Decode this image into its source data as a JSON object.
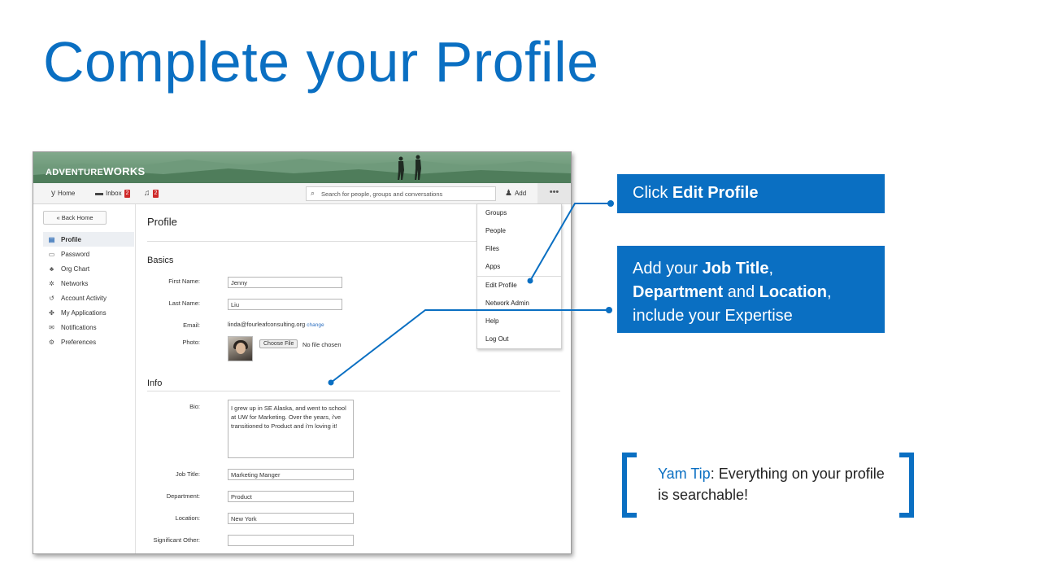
{
  "slide": {
    "title": "Complete your Profile",
    "accent_color": "#0a6fc2"
  },
  "app": {
    "brand": "ADVENTURE",
    "brand_bold": "WORKS",
    "nav": {
      "home_label": "Home",
      "inbox_label": "Inbox",
      "inbox_count": "2",
      "notifications_count": "2",
      "search_placeholder": "Search for people, groups and conversations",
      "add_label": "Add",
      "more_label": "•••"
    },
    "sidebar": {
      "back_label": "« Back Home",
      "items": [
        {
          "label": "Profile",
          "icon": "profile-card-icon",
          "active": true
        },
        {
          "label": "Password",
          "icon": "password-icon",
          "active": false
        },
        {
          "label": "Org Chart",
          "icon": "org-chart-icon",
          "active": false
        },
        {
          "label": "Networks",
          "icon": "networks-icon",
          "active": false
        },
        {
          "label": "Account Activity",
          "icon": "history-icon",
          "active": false
        },
        {
          "label": "My Applications",
          "icon": "puzzle-icon",
          "active": false
        },
        {
          "label": "Notifications",
          "icon": "notifications-icon",
          "active": false
        },
        {
          "label": "Preferences",
          "icon": "gear-icon",
          "active": false
        }
      ]
    },
    "main": {
      "heading": "Profile",
      "basics": {
        "heading": "Basics",
        "first_name_label": "First Name:",
        "first_name_value": "Jenny",
        "last_name_label": "Last Name:",
        "last_name_value": "Liu",
        "email_label": "Email:",
        "email_value": "linda@fourleafconsulting.org",
        "email_change": "change",
        "photo_label": "Photo:",
        "choose_file_label": "Choose File",
        "no_file_text": "No file chosen"
      },
      "info": {
        "heading": "Info",
        "bio_label": "Bio:",
        "bio_value": "I grew up in SE Alaska, and went to school at UW for Marketing.  Over the years, i've transitioned to Product and i'm loving it!",
        "job_title_label": "Job Title:",
        "job_title_value": "Marketing Manger",
        "department_label": "Department:",
        "department_value": "Product",
        "location_label": "Location:",
        "location_value": "New York",
        "significant_other_label": "Significant Other:",
        "significant_other_value": ""
      }
    },
    "dropdown": {
      "items": [
        "Groups",
        "People",
        "Files",
        "Apps",
        "Edit Profile",
        "Network Admin",
        "Help",
        "Log Out"
      ]
    }
  },
  "callouts": {
    "edit_profile": {
      "prefix": "Click ",
      "bold": "Edit Profile"
    },
    "job_title": {
      "line1_prefix": "Add your ",
      "line1_bold": "Job Title",
      "line1_suffix": ",",
      "line2_bold1": "Department",
      "line2_mid": " and ",
      "line2_bold2": "Location",
      "line2_suffix": ",",
      "line3": "include your Expertise"
    }
  },
  "tip": {
    "label": "Yam Tip",
    "text": ": Everything on your profile is searchable!"
  }
}
